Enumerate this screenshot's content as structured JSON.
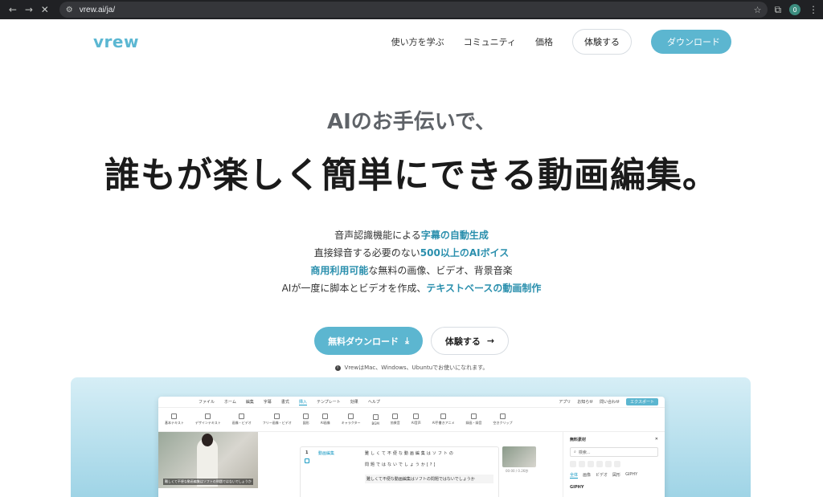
{
  "browser": {
    "url": "vrew.ai/ja/",
    "profile_initial": "0"
  },
  "header": {
    "logo": "vrew",
    "nav": [
      "使い方を学ぶ",
      "コミュニティ",
      "価格"
    ],
    "try_button": "体験する",
    "download_button": "ダウンロード"
  },
  "hero": {
    "subtitle": "AIのお手伝いで、",
    "title": "誰もが楽しく簡単にできる動画編集。",
    "features": [
      {
        "pre": "音声認識機能による",
        "hl": "字幕の自動生成",
        "post": ""
      },
      {
        "pre": "直接録音する必要のない",
        "hl": "500以上のAIボイス",
        "post": ""
      },
      {
        "pre": "",
        "hl": "商用利用可能",
        "post": "な無料の画像、ビデオ、背景音楽"
      },
      {
        "pre": "AIが一度に脚本とビデオを作成、",
        "hl": "テキストベースの動画制作",
        "post": ""
      }
    ],
    "cta_download": "無料ダウンロード",
    "cta_try": "体験する",
    "note": "VrewはMac、Windows、Ubuntuでお使いになれます。"
  },
  "app_preview": {
    "menu": [
      "ファイル",
      "ホーム",
      "編集",
      "字幕",
      "書式",
      "挿入",
      "テンプレート",
      "効果",
      "ヘルプ"
    ],
    "active_menu": "挿入",
    "right_menu": [
      "アプリ",
      "お知らせ",
      "問い合わせ"
    ],
    "export": "エクスポート",
    "tools": [
      "基本テキスト",
      "デザインテキスト",
      "画像・ビデオ",
      "フリー画像・ビデオ",
      "図形",
      "AI画像",
      "キャラクター",
      "BGM",
      "効果音",
      "AI音声",
      "AI手書きアニメ",
      "録画・録音",
      "空きクリップ"
    ],
    "video_caption": "難しくて不便な動画編集はソフトの問題ではないでしょうか",
    "clip_number": "1",
    "clip_name": "動画編集",
    "clip_text_1": "難しくて不便な動画編集はソフトの",
    "clip_text_2": "問題ではないでしょうか[?]",
    "clip_text_3": "難しくて不便な動画編集はソフトの問題ではないでしょうか",
    "thumb_time": "00:00 / 0.26秒",
    "side_title": "無料素材",
    "side_search": "検索...",
    "side_tabs": [
      "全体",
      "画像",
      "ビデオ",
      "図形",
      "GIPHY"
    ],
    "side_section": "GIPHY"
  }
}
